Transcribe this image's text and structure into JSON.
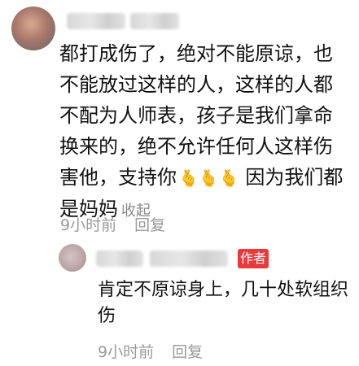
{
  "comment": {
    "text_before_emoji": "都打成伤了，绝对不能原谅，也不能放过这样的人，这样的人都不配为人师表，孩子是我们拿命换来的，绝不允许任何人这样伤害他，支持你",
    "emoji_icon": "finger-heart-emoji",
    "text_after_emoji": " 因为我们都是妈妈",
    "collapse_label": "收起",
    "time": "9小时前",
    "reply_label": "回复"
  },
  "reply": {
    "author_badge": "作者",
    "text": "肯定不原谅身上，几十处软组织伤",
    "time": "9小时前",
    "reply_label": "回复"
  }
}
